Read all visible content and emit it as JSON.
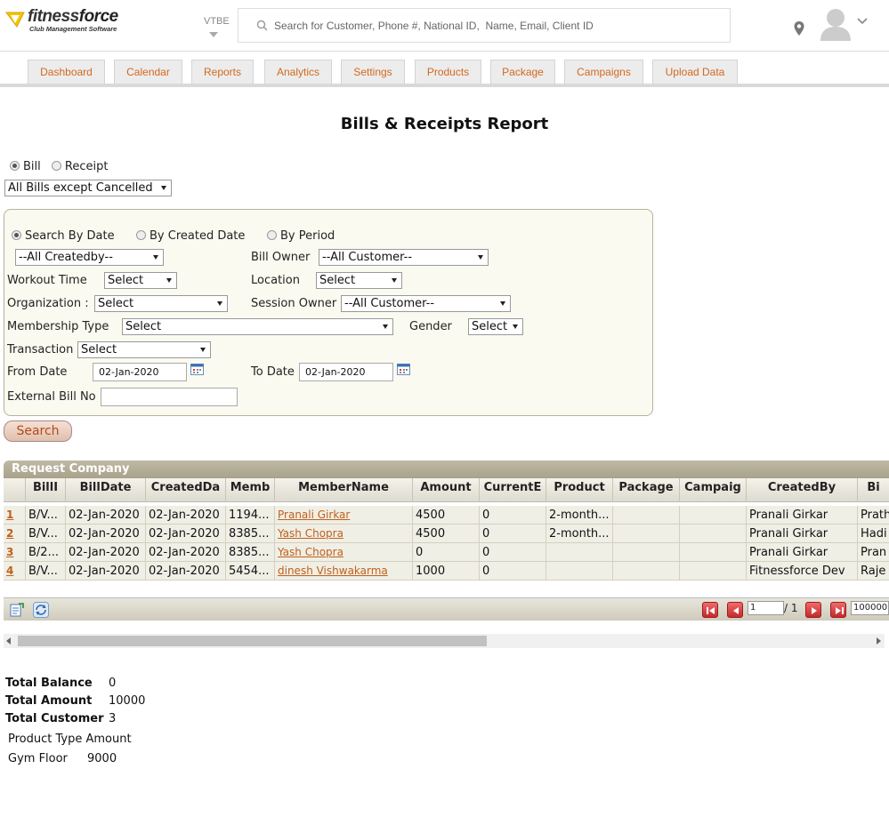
{
  "header": {
    "brand_fitness": "fitness",
    "brand_force": "force",
    "tagline": "Club Management Software",
    "vtbe": "VTBE",
    "search_placeholder": "Search for Customer, Phone #, National ID,  Name, Email, Client ID"
  },
  "nav": {
    "tabs": [
      "Dashboard",
      "Calendar",
      "Reports",
      "Analytics",
      "Settings",
      "Products",
      "Package",
      "Campaigns",
      "Upload Data"
    ]
  },
  "page": {
    "title": "Bills & Receipts Report",
    "type_bill": "Bill",
    "type_receipt": "Receipt",
    "bill_filter": "All Bills except Cancelled"
  },
  "filters": {
    "search_by_date": "Search By Date",
    "by_created_date": "By Created Date",
    "by_period": "By Period",
    "created_by": "--All Createdby--",
    "bill_owner_label": "Bill Owner",
    "bill_owner": "--All Customer--",
    "workout_time_label": "Workout Time",
    "workout_time": "Select",
    "location_label": "Location",
    "location": "Select",
    "organization_label": "Organization :",
    "organization": "Select",
    "session_owner_label": "Session Owner",
    "session_owner": "--All Customer--",
    "membership_type_label": "Membership Type",
    "membership_type": "Select",
    "gender_label": "Gender",
    "gender": "Select",
    "transaction_label": "Transaction",
    "transaction": "Select",
    "from_date_label": "From Date",
    "from_date": "02-Jan-2020",
    "to_date_label": "To Date",
    "to_date": "02-Jan-2020",
    "external_bill_label": "External Bill No",
    "external_bill": "",
    "search_button": "Search"
  },
  "grid": {
    "caption": "Request Company",
    "headers": [
      "BillI",
      "BillDate",
      "CreatedDa",
      "Memb",
      "MemberName",
      "Amount",
      "CurrentE",
      "Product",
      "Package",
      "Campaig",
      "CreatedBy",
      "Bi"
    ],
    "rows": [
      {
        "n": "1",
        "bill": "B/V...",
        "date": "02-Jan-2020",
        "created": "02-Jan-2020",
        "memb": "1194...",
        "name": "Pranali Girkar",
        "amount": "4500",
        "current": "0",
        "product": "2-month...",
        "package": "",
        "campaign": "",
        "createdby": "Pranali Girkar",
        "bi": "Prath"
      },
      {
        "n": "2",
        "bill": "B/V...",
        "date": "02-Jan-2020",
        "created": "02-Jan-2020",
        "memb": "8385...",
        "name": "Yash Chopra",
        "amount": "4500",
        "current": "0",
        "product": "2-month...",
        "package": "",
        "campaign": "",
        "createdby": "Pranali Girkar",
        "bi": "Hadi"
      },
      {
        "n": "3",
        "bill": "B/2...",
        "date": "02-Jan-2020",
        "created": "02-Jan-2020",
        "memb": "8385...",
        "name": "Yash Chopra",
        "amount": "0",
        "current": "0",
        "product": "",
        "package": "",
        "campaign": "",
        "createdby": "Pranali Girkar",
        "bi": "Pran"
      },
      {
        "n": "4",
        "bill": "B/V...",
        "date": "02-Jan-2020",
        "created": "02-Jan-2020",
        "memb": "5454...",
        "name": "dinesh Vishwakarma",
        "amount": "1000",
        "current": "0",
        "product": "",
        "package": "",
        "campaign": "",
        "createdby": "Fitnessforce Dev",
        "bi": "Raje"
      }
    ]
  },
  "pager": {
    "page": "1",
    "of": "/ 1",
    "page_size": "100000"
  },
  "totals": {
    "balance_label": "Total Balance",
    "balance": "0",
    "amount_label": "Total Amount",
    "amount": "10000",
    "customer_label": "Total Customer",
    "customer": "3",
    "product_type_header": "Product Type Amount",
    "product_type": "Gym Floor",
    "product_amount": "9000"
  }
}
